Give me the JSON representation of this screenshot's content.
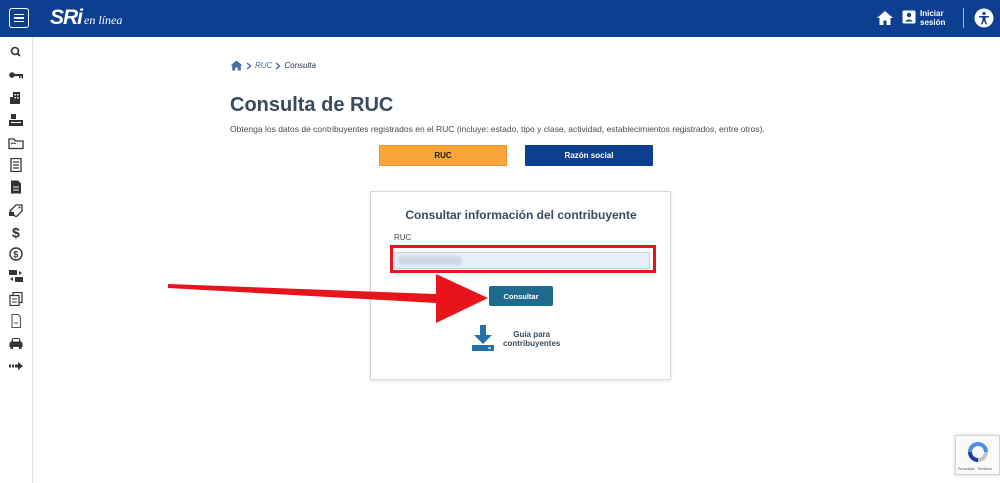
{
  "header": {
    "logo_main": "SRi",
    "logo_sub": "en línea",
    "login_line1": "Iniciar",
    "login_line2": "sesión"
  },
  "sidebar": {
    "icons": [
      "search-icon",
      "key-icon",
      "building-icon",
      "register-icon",
      "folder-icon",
      "document-icon",
      "file-icon",
      "tag-icon",
      "dollar-icon",
      "coin-icon",
      "exchange-icon",
      "copy-icon",
      "page-icon",
      "car-icon",
      "arrow-right-icon"
    ]
  },
  "breadcrumb": {
    "item1": "RUC",
    "item2": "Consulta"
  },
  "main": {
    "title": "Consulta de RUC",
    "description": "Obtenga los datos de contribuyentes registrados en el RUC (incluye: estado, tipo y clase, actividad, establecimientos registrados, entre otros).",
    "tab_ruc": "RUC",
    "tab_razon": "Razón social"
  },
  "card": {
    "title": "Consultar información del contribuyente",
    "field_label": "RUC",
    "input_value": "",
    "submit_label": "Consultar",
    "guide_line1": "Guía para",
    "guide_line2": "contribuyentes"
  },
  "colors": {
    "header_bg": "#0d3f91",
    "tab_active": "#f9a53a",
    "button": "#1f6b8e",
    "highlight": "#e8141c"
  }
}
